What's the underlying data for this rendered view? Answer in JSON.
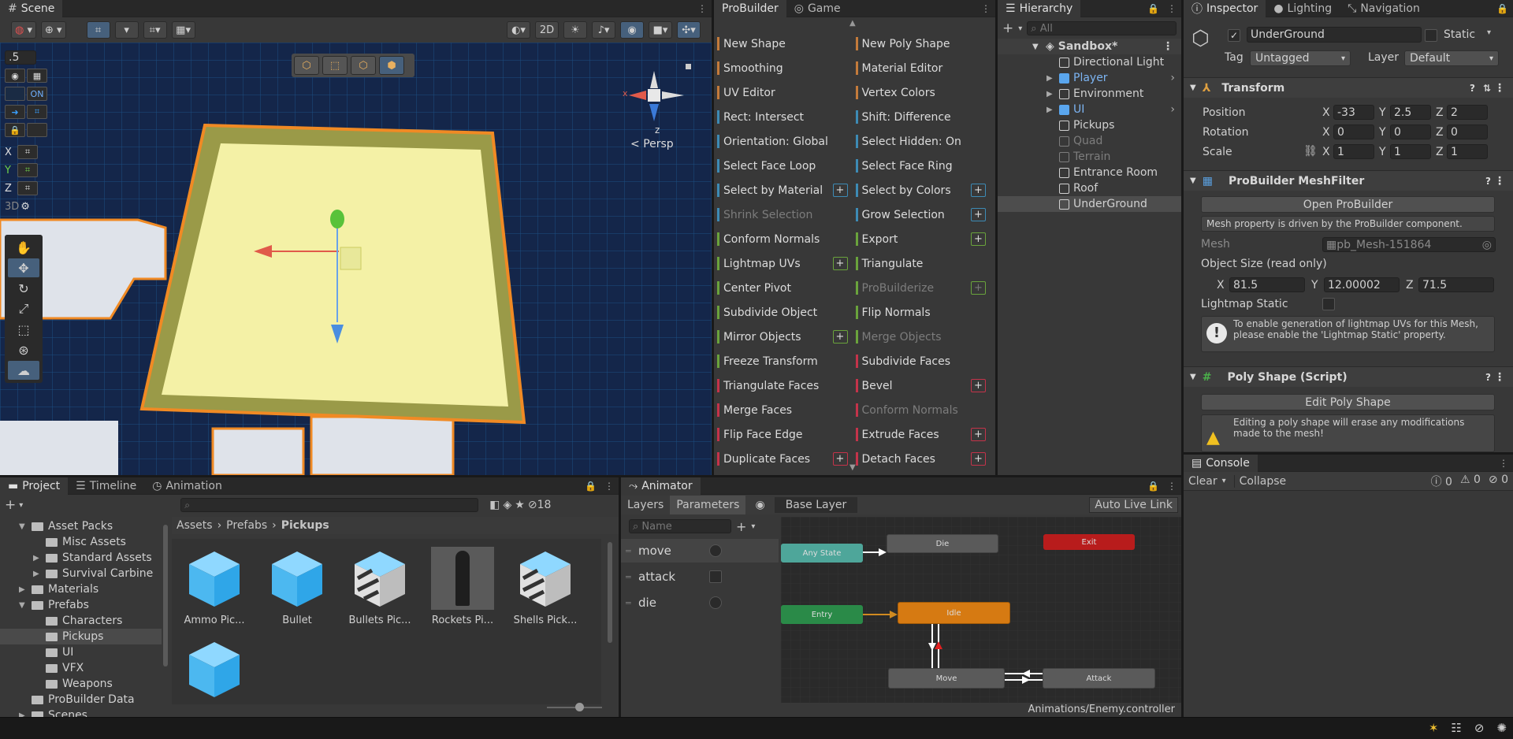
{
  "scene": {
    "tab": "Scene",
    "toolbar": {
      "two_d": "2D"
    },
    "snap_value": ".5",
    "on_label": "ON",
    "axes": [
      "X",
      "Y",
      "Z"
    ],
    "three_d": "3D",
    "persp_label": "Persp",
    "gizmo_z": "z",
    "gizmo_x": "x"
  },
  "probuilder": {
    "tabs": [
      "ProBuilder",
      "Game"
    ],
    "items": [
      {
        "label": "New Shape",
        "color": "#c47b3b",
        "plus": false,
        "disabled": false
      },
      {
        "label": "New Poly Shape",
        "color": "#c47b3b",
        "plus": false,
        "disabled": false
      },
      {
        "label": "Smoothing",
        "color": "#c47b3b",
        "plus": false,
        "disabled": false
      },
      {
        "label": "Material Editor",
        "color": "#c47b3b",
        "plus": false,
        "disabled": false
      },
      {
        "label": "UV Editor",
        "color": "#c47b3b",
        "plus": false,
        "disabled": false
      },
      {
        "label": "Vertex Colors",
        "color": "#c47b3b",
        "plus": false,
        "disabled": false
      },
      {
        "label": "Rect: Intersect",
        "color": "#3d8bb5",
        "plus": false,
        "disabled": false
      },
      {
        "label": "Shift: Difference",
        "color": "#3d8bb5",
        "plus": false,
        "disabled": false
      },
      {
        "label": "Orientation: Global",
        "color": "#3d8bb5",
        "plus": false,
        "disabled": false
      },
      {
        "label": "Select Hidden: On",
        "color": "#3d8bb5",
        "plus": false,
        "disabled": false
      },
      {
        "label": "Select Face Loop",
        "color": "#3d8bb5",
        "plus": false,
        "disabled": false
      },
      {
        "label": "Select Face Ring",
        "color": "#3d8bb5",
        "plus": false,
        "disabled": false
      },
      {
        "label": "Select by Material",
        "color": "#3d8bb5",
        "plus": true,
        "disabled": false
      },
      {
        "label": "Select by Colors",
        "color": "#3d8bb5",
        "plus": true,
        "disabled": false
      },
      {
        "label": "Shrink Selection",
        "color": "#3d8bb5",
        "plus": false,
        "disabled": true
      },
      {
        "label": "Grow Selection",
        "color": "#3d8bb5",
        "plus": true,
        "disabled": false
      },
      {
        "label": "Conform Normals",
        "color": "#6aa33c",
        "plus": false,
        "disabled": false
      },
      {
        "label": "Export",
        "color": "#6aa33c",
        "plus": true,
        "disabled": false
      },
      {
        "label": "Lightmap UVs",
        "color": "#6aa33c",
        "plus": true,
        "disabled": false
      },
      {
        "label": "Triangulate",
        "color": "#6aa33c",
        "plus": false,
        "disabled": false
      },
      {
        "label": "Center Pivot",
        "color": "#6aa33c",
        "plus": false,
        "disabled": false
      },
      {
        "label": "ProBuilderize",
        "color": "#6aa33c",
        "plus": true,
        "disabled": true
      },
      {
        "label": "Subdivide Object",
        "color": "#6aa33c",
        "plus": false,
        "disabled": false
      },
      {
        "label": "Flip Normals",
        "color": "#6aa33c",
        "plus": false,
        "disabled": false
      },
      {
        "label": "Mirror Objects",
        "color": "#6aa33c",
        "plus": true,
        "disabled": false
      },
      {
        "label": "Merge Objects",
        "color": "#6aa33c",
        "plus": false,
        "disabled": true
      },
      {
        "label": "Freeze Transform",
        "color": "#6aa33c",
        "plus": false,
        "disabled": false
      },
      {
        "label": "Subdivide Faces",
        "color": "#c4334a",
        "plus": false,
        "disabled": false
      },
      {
        "label": "Triangulate Faces",
        "color": "#c4334a",
        "plus": false,
        "disabled": false
      },
      {
        "label": "Bevel",
        "color": "#c4334a",
        "plus": true,
        "disabled": false
      },
      {
        "label": "Merge Faces",
        "color": "#c4334a",
        "plus": false,
        "disabled": false
      },
      {
        "label": "Conform Normals",
        "color": "#c4334a",
        "plus": false,
        "disabled": true
      },
      {
        "label": "Flip Face Edge",
        "color": "#c4334a",
        "plus": false,
        "disabled": false
      },
      {
        "label": "Extrude Faces",
        "color": "#c4334a",
        "plus": true,
        "disabled": false
      },
      {
        "label": "Duplicate Faces",
        "color": "#c4334a",
        "plus": true,
        "disabled": false
      },
      {
        "label": "Detach Faces",
        "color": "#c4334a",
        "plus": true,
        "disabled": false
      }
    ]
  },
  "hierarchy": {
    "tab": "Hierarchy",
    "search_placeholder": "All",
    "root": "Sandbox*",
    "items": [
      {
        "label": "Directional Light",
        "style": "normal",
        "arrow": false,
        "icon": "gameobject-icon"
      },
      {
        "label": "Player",
        "style": "blue",
        "arrow": true,
        "icon": "prefab-icon"
      },
      {
        "label": "Environment",
        "style": "normal",
        "arrow": true,
        "icon": "gameobject-icon"
      },
      {
        "label": "UI",
        "style": "blue",
        "arrow": true,
        "icon": "prefab-icon"
      },
      {
        "label": "Pickups",
        "style": "normal",
        "arrow": false,
        "icon": "gameobject-icon"
      },
      {
        "label": "Quad",
        "style": "dim",
        "arrow": false,
        "icon": "gameobject-icon"
      },
      {
        "label": "Terrain",
        "style": "dim",
        "arrow": false,
        "icon": "gameobject-icon"
      },
      {
        "label": "Entrance Room",
        "style": "normal",
        "arrow": false,
        "icon": "gameobject-icon"
      },
      {
        "label": "Roof",
        "style": "normal",
        "arrow": false,
        "icon": "gameobject-icon"
      },
      {
        "label": "UnderGround",
        "style": "selected",
        "arrow": false,
        "icon": "gameobject-icon"
      }
    ]
  },
  "inspector": {
    "tabs": [
      "Inspector",
      "Lighting",
      "Navigation"
    ],
    "object_name": "UnderGround",
    "static_label": "Static",
    "tag_label": "Tag",
    "tag_value": "Untagged",
    "layer_label": "Layer",
    "layer_value": "Default",
    "transform": {
      "title": "Transform",
      "position_label": "Position",
      "rotation_label": "Rotation",
      "scale_label": "Scale",
      "position": [
        "-33",
        "2.5",
        "2"
      ],
      "rotation": [
        "0",
        "0",
        "0"
      ],
      "scale": [
        "1",
        "1",
        "1"
      ]
    },
    "meshfilter": {
      "title": "ProBuilder MeshFilter",
      "open_button": "Open ProBuilder",
      "driven_note": "Mesh property is driven by the ProBuilder component.",
      "mesh_label": "Mesh",
      "mesh_value": "pb_Mesh-151864",
      "size_label": "Object Size (read only)",
      "size": [
        "81.5",
        "12.00002",
        "71.5"
      ],
      "lightmap_label": "Lightmap Static",
      "lightmap_help": "To enable generation of lightmap UVs for this Mesh, please enable the 'Lightmap Static' property."
    },
    "polyshape": {
      "title": "Poly Shape (Script)",
      "edit_button": "Edit Poly Shape",
      "warning": "Editing a poly shape will erase any modifications made to the mesh!"
    }
  },
  "console": {
    "tab": "Console",
    "clear": "Clear",
    "collapse": "Collapse",
    "counts": [
      "0",
      "0",
      "0"
    ]
  },
  "project": {
    "tabs": [
      "Project",
      "Timeline",
      "Animation"
    ],
    "hidden_count": "18",
    "tree": [
      {
        "label": "Asset Packs",
        "indent": 1,
        "arrow": "down"
      },
      {
        "label": "Misc Assets",
        "indent": 2,
        "arrow": ""
      },
      {
        "label": "Standard Assets",
        "indent": 2,
        "arrow": "right"
      },
      {
        "label": "Survival Carbine",
        "indent": 2,
        "arrow": "right"
      },
      {
        "label": "Materials",
        "indent": 1,
        "arrow": "right"
      },
      {
        "label": "Prefabs",
        "indent": 1,
        "arrow": "down"
      },
      {
        "label": "Characters",
        "indent": 2,
        "arrow": ""
      },
      {
        "label": "Pickups",
        "indent": 2,
        "arrow": "",
        "selected": true
      },
      {
        "label": "UI",
        "indent": 2,
        "arrow": ""
      },
      {
        "label": "VFX",
        "indent": 2,
        "arrow": ""
      },
      {
        "label": "Weapons",
        "indent": 2,
        "arrow": ""
      },
      {
        "label": "ProBuilder Data",
        "indent": 1,
        "arrow": ""
      },
      {
        "label": "Scenes",
        "indent": 1,
        "arrow": "right"
      }
    ],
    "breadcrumb": [
      "Assets",
      "Prefabs",
      "Pickups"
    ],
    "assets": [
      {
        "label": "Ammo Pic...",
        "kind": "cube"
      },
      {
        "label": "Bullet",
        "kind": "cube"
      },
      {
        "label": "Bullets Pic...",
        "kind": "striped"
      },
      {
        "label": "Rockets Pi...",
        "kind": "rocket"
      },
      {
        "label": "Shells Pick...",
        "kind": "striped"
      },
      {
        "label": "",
        "kind": "cube"
      }
    ]
  },
  "animator": {
    "tab": "Animator",
    "layers_tab": "Layers",
    "params_tab": "Parameters",
    "base_layer": "Base Layer",
    "auto_live": "Auto Live Link",
    "name_placeholder": "Name",
    "params": [
      {
        "name": "move",
        "type": "circle"
      },
      {
        "name": "attack",
        "type": "square"
      },
      {
        "name": "die",
        "type": "circle"
      }
    ],
    "nodes": {
      "any": "Any State",
      "die": "Die",
      "exit": "Exit",
      "entry": "Entry",
      "idle": "Idle",
      "move": "Move",
      "attack": "Attack"
    },
    "path": "Animations/Enemy.controller"
  },
  "colors": {
    "accent": "#46607c",
    "selection_orange": "#f08a24",
    "floor": "#f4f1a6"
  }
}
